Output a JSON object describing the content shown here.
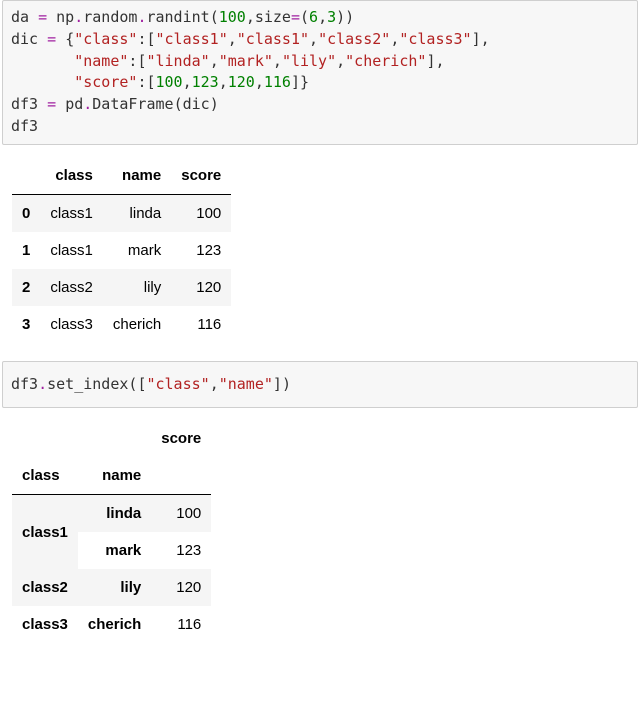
{
  "cell1": {
    "line1": {
      "da": "da",
      "eq": " = ",
      "np": "np",
      "dot1": ".",
      "random": "random",
      "dot2": ".",
      "randint": "randint",
      "op": "(",
      "n100": "100",
      "comma": ",",
      "size": "size",
      "eq2": "=",
      "op2": "(",
      "n6": "6",
      "comma2": ",",
      "n3": "3",
      "cp2": ")",
      "cp": ")"
    },
    "line2": {
      "dic": "dic",
      "eq": " = ",
      "ob": "{",
      "k_class": "\"class\"",
      "colon": ":",
      "ob2": "[",
      "v1": "\"class1\"",
      "c1": ",",
      "v2": "\"class1\"",
      "c2": ",",
      "v3": "\"class2\"",
      "c3": ",",
      "v4": "\"class3\"",
      "cb2": "]",
      "c4": ","
    },
    "line3": {
      "pad": "       ",
      "k_name": "\"name\"",
      "colon": ":",
      "ob": "[",
      "v1": "\"linda\"",
      "c1": ",",
      "v2": "\"mark\"",
      "c2": ",",
      "v3": "\"lily\"",
      "c3": ",",
      "v4": "\"cherich\"",
      "cb": "]",
      "c4": ","
    },
    "line4": {
      "pad": "       ",
      "k_score": "\"score\"",
      "colon": ":",
      "ob": "[",
      "n1": "100",
      "c1": ",",
      "n2": "123",
      "c2": ",",
      "n3": "120",
      "c3": ",",
      "n4": "116",
      "cb": "]",
      "cbrace": "}"
    },
    "line5": {
      "df3": "df3",
      "eq": " = ",
      "pd": "pd",
      "dot": ".",
      "DataFrame": "DataFrame",
      "op": "(",
      "dic": "dic",
      "cp": ")"
    },
    "line6": {
      "df3": "df3"
    }
  },
  "table1": {
    "headers": {
      "h0": "",
      "h1": "class",
      "h2": "name",
      "h3": "score"
    },
    "rows": [
      {
        "idx": "0",
        "class": "class1",
        "name": "linda",
        "score": "100"
      },
      {
        "idx": "1",
        "class": "class1",
        "name": "mark",
        "score": "123"
      },
      {
        "idx": "2",
        "class": "class2",
        "name": "lily",
        "score": "120"
      },
      {
        "idx": "3",
        "class": "class3",
        "name": "cherich",
        "score": "116"
      }
    ]
  },
  "cell2": {
    "df3": "df3",
    "dot": ".",
    "set_index": "set_index",
    "op": "(",
    "ob": "[",
    "s1": "\"class\"",
    "c1": ",",
    "s2": "\"name\"",
    "cb": "]",
    "cp": ")"
  },
  "table2": {
    "top": {
      "blank1": "",
      "blank2": "",
      "score": "score"
    },
    "idxnames": {
      "l0": "class",
      "l1": "name",
      "blank": ""
    },
    "rows": [
      {
        "l0": "class1",
        "l1": "linda",
        "score": "100",
        "l0_rowspan": 2
      },
      {
        "l0": "",
        "l1": "mark",
        "score": "123"
      },
      {
        "l0": "class2",
        "l1": "lily",
        "score": "120",
        "l0_rowspan": 1
      },
      {
        "l0": "class3",
        "l1": "cherich",
        "score": "116",
        "l0_rowspan": 1
      }
    ]
  },
  "chart_data": [
    {
      "type": "table",
      "title": "df3",
      "columns": [
        "class",
        "name",
        "score"
      ],
      "index": [
        0,
        1,
        2,
        3
      ],
      "data": [
        [
          "class1",
          "linda",
          100
        ],
        [
          "class1",
          "mark",
          123
        ],
        [
          "class2",
          "lily",
          120
        ],
        [
          "class3",
          "cherich",
          116
        ]
      ]
    },
    {
      "type": "table",
      "title": "df3.set_index([\"class\",\"name\"])",
      "columns": [
        "score"
      ],
      "index_names": [
        "class",
        "name"
      ],
      "index": [
        [
          "class1",
          "linda"
        ],
        [
          "class1",
          "mark"
        ],
        [
          "class2",
          "lily"
        ],
        [
          "class3",
          "cherich"
        ]
      ],
      "data": [
        [
          100
        ],
        [
          123
        ],
        [
          120
        ],
        [
          116
        ]
      ]
    }
  ]
}
